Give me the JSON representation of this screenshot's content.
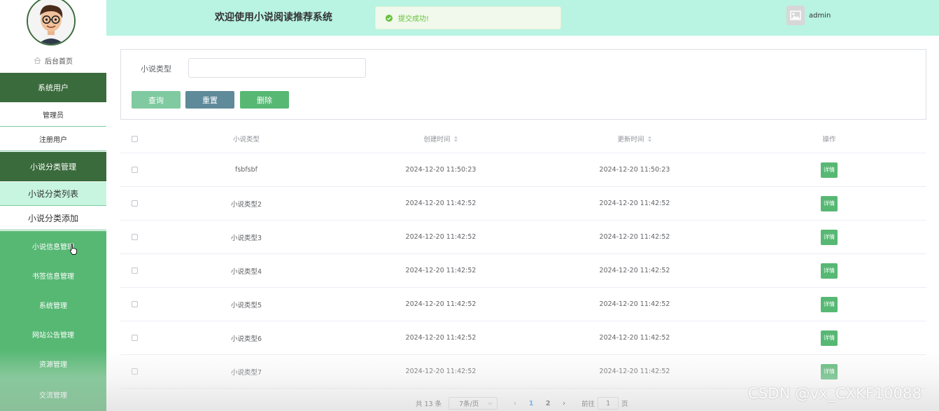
{
  "header": {
    "site_title": "欢迎使用小说阅读推荐系统",
    "toast_message": "提交成功!",
    "user_name": "admin"
  },
  "sidebar": {
    "home_label": "后台首页",
    "items": [
      {
        "label": "系统用户"
      },
      {
        "label": "管理员"
      },
      {
        "label": "注册用户"
      },
      {
        "label": "小说分类管理"
      },
      {
        "label": "小说分类列表"
      },
      {
        "label": "小说分类添加"
      },
      {
        "label": "小说信息管理"
      },
      {
        "label": "书签信息管理"
      },
      {
        "label": "系统管理"
      },
      {
        "label": "网站公告管理"
      },
      {
        "label": "资源管理"
      },
      {
        "label": "交流管理"
      }
    ]
  },
  "search": {
    "label": "小说类型",
    "input_value": "",
    "query_button": "查询",
    "reset_button": "重置",
    "delete_button": "删除"
  },
  "table": {
    "headers": [
      "小说类型",
      "创建时间",
      "更新时间",
      "操作"
    ],
    "detail_label": "详情",
    "rows": [
      {
        "type": "fsbfsbf",
        "created": "2024-12-20 11:50:23",
        "updated": "2024-12-20 11:50:23"
      },
      {
        "type": "小说类型2",
        "created": "2024-12-20 11:42:52",
        "updated": "2024-12-20 11:42:52"
      },
      {
        "type": "小说类型3",
        "created": "2024-12-20 11:42:52",
        "updated": "2024-12-20 11:42:52"
      },
      {
        "type": "小说类型4",
        "created": "2024-12-20 11:42:52",
        "updated": "2024-12-20 11:42:52"
      },
      {
        "type": "小说类型5",
        "created": "2024-12-20 11:42:52",
        "updated": "2024-12-20 11:42:52"
      },
      {
        "type": "小说类型6",
        "created": "2024-12-20 11:42:52",
        "updated": "2024-12-20 11:42:52"
      },
      {
        "type": "小说类型7",
        "created": "2024-12-20 11:42:52",
        "updated": "2024-12-20 11:42:52"
      }
    ]
  },
  "pagination": {
    "total": "共 13 条",
    "page_size": "7条/页",
    "pages": [
      "1",
      "2"
    ],
    "goto_label": "前往",
    "goto_value": "1",
    "page_unit": "页"
  },
  "watermark": "CSDN @vx_CXKF10088",
  "colors": {
    "header_bg": "#b9f3e1",
    "menu_dark": "#3a6b3c",
    "menu_green": "#57b874",
    "menu_active": "#c7f5df",
    "accent_blue": "#409eff"
  }
}
